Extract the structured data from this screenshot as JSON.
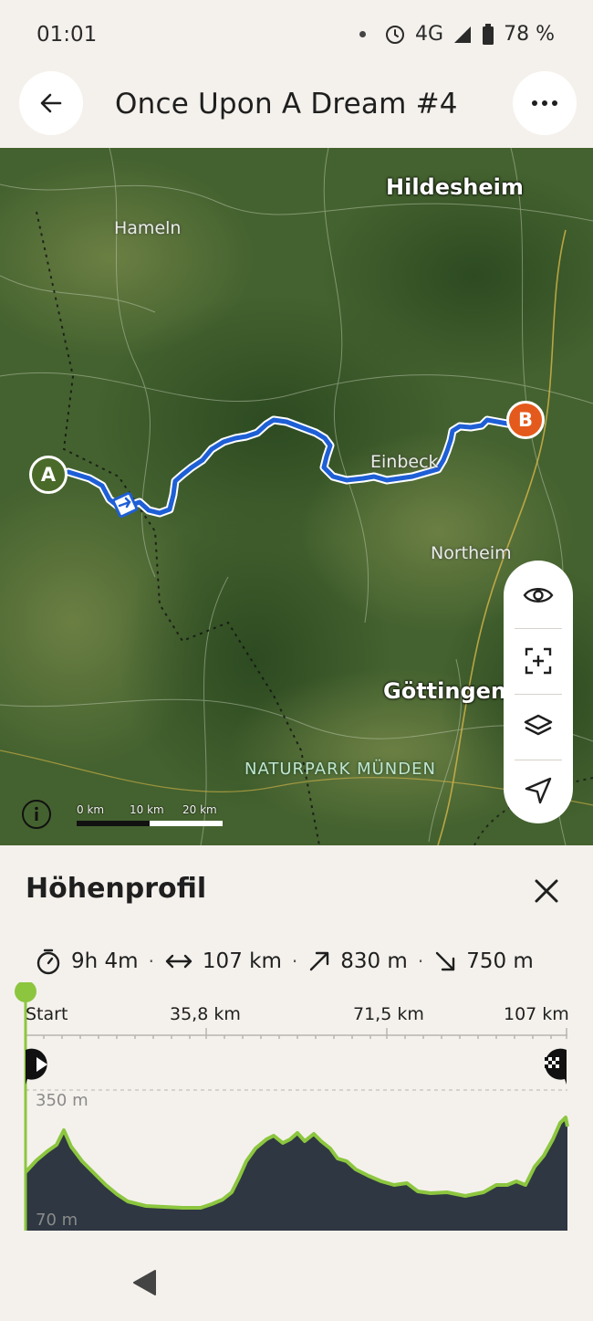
{
  "status": {
    "time": "01:01",
    "network": "4G",
    "battery": "78 %"
  },
  "header": {
    "title": "Once Upon A Dream #4"
  },
  "map": {
    "cities": {
      "hildesheim": "Hildesheim",
      "hameln": "Hameln",
      "einbeck": "Einbeck",
      "northeim": "Northeim",
      "goettingen": "Göttingen",
      "naturpark": "NATURPARK MÜNDEN"
    },
    "markers": {
      "start": "A",
      "end": "B"
    },
    "scale": {
      "l0": "0 km",
      "l1": "10 km",
      "l2": "20 km"
    },
    "route_color": "#1e5fd6"
  },
  "panel": {
    "title": "Höhenprofil",
    "stats": {
      "duration": "9h 4m",
      "distance": "107 km",
      "ascent": "830 m",
      "descent": "750 m"
    },
    "axis": {
      "start": "Start",
      "d1": "35,8 km",
      "d2": "71,5 km",
      "d3": "107 km"
    },
    "elevation": {
      "max_label": "350 m",
      "min_label": "70 m"
    },
    "accent": "#8cc63f"
  }
}
